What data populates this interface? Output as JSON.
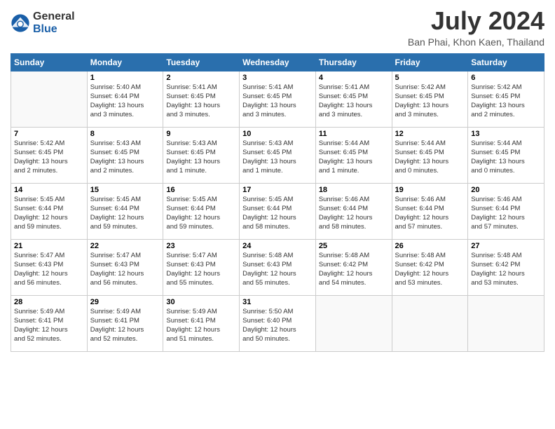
{
  "logo": {
    "general": "General",
    "blue": "Blue"
  },
  "title": "July 2024",
  "subtitle": "Ban Phai, Khon Kaen, Thailand",
  "weekdays": [
    "Sunday",
    "Monday",
    "Tuesday",
    "Wednesday",
    "Thursday",
    "Friday",
    "Saturday"
  ],
  "weeks": [
    [
      {
        "day": "",
        "info": ""
      },
      {
        "day": "1",
        "info": "Sunrise: 5:40 AM\nSunset: 6:44 PM\nDaylight: 13 hours\nand 3 minutes."
      },
      {
        "day": "2",
        "info": "Sunrise: 5:41 AM\nSunset: 6:45 PM\nDaylight: 13 hours\nand 3 minutes."
      },
      {
        "day": "3",
        "info": "Sunrise: 5:41 AM\nSunset: 6:45 PM\nDaylight: 13 hours\nand 3 minutes."
      },
      {
        "day": "4",
        "info": "Sunrise: 5:41 AM\nSunset: 6:45 PM\nDaylight: 13 hours\nand 3 minutes."
      },
      {
        "day": "5",
        "info": "Sunrise: 5:42 AM\nSunset: 6:45 PM\nDaylight: 13 hours\nand 3 minutes."
      },
      {
        "day": "6",
        "info": "Sunrise: 5:42 AM\nSunset: 6:45 PM\nDaylight: 13 hours\nand 2 minutes."
      }
    ],
    [
      {
        "day": "7",
        "info": "Sunrise: 5:42 AM\nSunset: 6:45 PM\nDaylight: 13 hours\nand 2 minutes."
      },
      {
        "day": "8",
        "info": "Sunrise: 5:43 AM\nSunset: 6:45 PM\nDaylight: 13 hours\nand 2 minutes."
      },
      {
        "day": "9",
        "info": "Sunrise: 5:43 AM\nSunset: 6:45 PM\nDaylight: 13 hours\nand 1 minute."
      },
      {
        "day": "10",
        "info": "Sunrise: 5:43 AM\nSunset: 6:45 PM\nDaylight: 13 hours\nand 1 minute."
      },
      {
        "day": "11",
        "info": "Sunrise: 5:44 AM\nSunset: 6:45 PM\nDaylight: 13 hours\nand 1 minute."
      },
      {
        "day": "12",
        "info": "Sunrise: 5:44 AM\nSunset: 6:45 PM\nDaylight: 13 hours\nand 0 minutes."
      },
      {
        "day": "13",
        "info": "Sunrise: 5:44 AM\nSunset: 6:45 PM\nDaylight: 13 hours\nand 0 minutes."
      }
    ],
    [
      {
        "day": "14",
        "info": "Sunrise: 5:45 AM\nSunset: 6:44 PM\nDaylight: 12 hours\nand 59 minutes."
      },
      {
        "day": "15",
        "info": "Sunrise: 5:45 AM\nSunset: 6:44 PM\nDaylight: 12 hours\nand 59 minutes."
      },
      {
        "day": "16",
        "info": "Sunrise: 5:45 AM\nSunset: 6:44 PM\nDaylight: 12 hours\nand 59 minutes."
      },
      {
        "day": "17",
        "info": "Sunrise: 5:45 AM\nSunset: 6:44 PM\nDaylight: 12 hours\nand 58 minutes."
      },
      {
        "day": "18",
        "info": "Sunrise: 5:46 AM\nSunset: 6:44 PM\nDaylight: 12 hours\nand 58 minutes."
      },
      {
        "day": "19",
        "info": "Sunrise: 5:46 AM\nSunset: 6:44 PM\nDaylight: 12 hours\nand 57 minutes."
      },
      {
        "day": "20",
        "info": "Sunrise: 5:46 AM\nSunset: 6:44 PM\nDaylight: 12 hours\nand 57 minutes."
      }
    ],
    [
      {
        "day": "21",
        "info": "Sunrise: 5:47 AM\nSunset: 6:43 PM\nDaylight: 12 hours\nand 56 minutes."
      },
      {
        "day": "22",
        "info": "Sunrise: 5:47 AM\nSunset: 6:43 PM\nDaylight: 12 hours\nand 56 minutes."
      },
      {
        "day": "23",
        "info": "Sunrise: 5:47 AM\nSunset: 6:43 PM\nDaylight: 12 hours\nand 55 minutes."
      },
      {
        "day": "24",
        "info": "Sunrise: 5:48 AM\nSunset: 6:43 PM\nDaylight: 12 hours\nand 55 minutes."
      },
      {
        "day": "25",
        "info": "Sunrise: 5:48 AM\nSunset: 6:42 PM\nDaylight: 12 hours\nand 54 minutes."
      },
      {
        "day": "26",
        "info": "Sunrise: 5:48 AM\nSunset: 6:42 PM\nDaylight: 12 hours\nand 53 minutes."
      },
      {
        "day": "27",
        "info": "Sunrise: 5:48 AM\nSunset: 6:42 PM\nDaylight: 12 hours\nand 53 minutes."
      }
    ],
    [
      {
        "day": "28",
        "info": "Sunrise: 5:49 AM\nSunset: 6:41 PM\nDaylight: 12 hours\nand 52 minutes."
      },
      {
        "day": "29",
        "info": "Sunrise: 5:49 AM\nSunset: 6:41 PM\nDaylight: 12 hours\nand 52 minutes."
      },
      {
        "day": "30",
        "info": "Sunrise: 5:49 AM\nSunset: 6:41 PM\nDaylight: 12 hours\nand 51 minutes."
      },
      {
        "day": "31",
        "info": "Sunrise: 5:50 AM\nSunset: 6:40 PM\nDaylight: 12 hours\nand 50 minutes."
      },
      {
        "day": "",
        "info": ""
      },
      {
        "day": "",
        "info": ""
      },
      {
        "day": "",
        "info": ""
      }
    ]
  ]
}
